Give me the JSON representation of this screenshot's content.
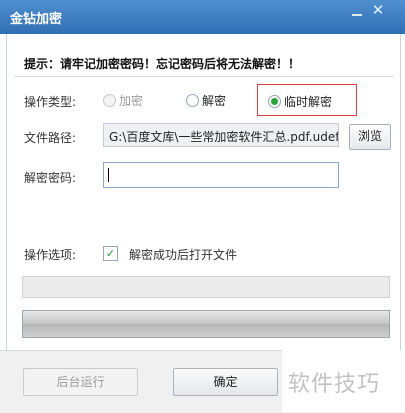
{
  "window": {
    "title": "金钻加密",
    "minimize_icon": "minimize-icon",
    "close_icon": "close-icon",
    "close_glyph": "✕"
  },
  "warning": "提示：请牢记加密密码！忘记密码后将无法解密！！",
  "operation": {
    "label": "操作类型:",
    "options": [
      {
        "label": "加密",
        "enabled": false,
        "selected": false
      },
      {
        "label": "解密",
        "enabled": true,
        "selected": false
      },
      {
        "label": "临时解密",
        "enabled": true,
        "selected": true
      }
    ]
  },
  "file_path": {
    "label": "文件路径:",
    "value": "G:\\百度文库\\一些常加密软件汇总.pdf.udef",
    "browse_label": "浏览"
  },
  "password": {
    "label": "解密密码:",
    "value": ""
  },
  "options": {
    "label": "操作选项:",
    "open_after_decrypt": {
      "label": "解密成功后打开文件",
      "checked": true,
      "check_glyph": "✓"
    }
  },
  "footer": {
    "background_label": "后台运行",
    "confirm_label": "确定"
  },
  "watermark": "软件技巧",
  "colors": {
    "title_bar": "#2f6fb3",
    "highlight": "#d9413a",
    "radio_selected": "#2aa33a"
  }
}
